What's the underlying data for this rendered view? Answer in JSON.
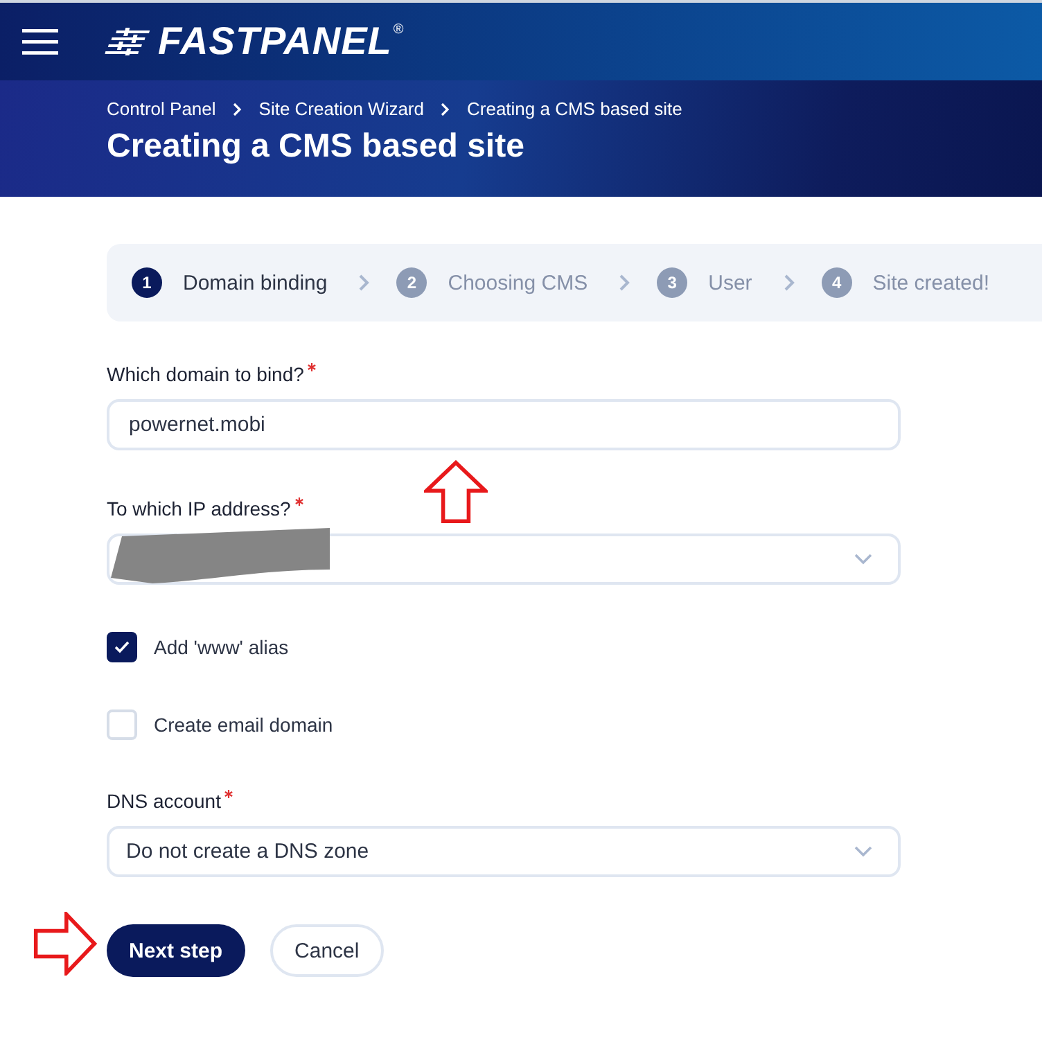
{
  "header": {
    "logo": "FASTPANEL",
    "logo_mark": "®"
  },
  "breadcrumbs": [
    "Control Panel",
    "Site Creation Wizard",
    "Creating a CMS based site"
  ],
  "page_title": "Creating a CMS based site",
  "steps": [
    {
      "number": "1",
      "label": "Domain binding",
      "selected": true
    },
    {
      "number": "2",
      "label": "Choosing CMS",
      "selected": false
    },
    {
      "number": "3",
      "label": "User",
      "selected": false
    },
    {
      "number": "4",
      "label": "Site created!",
      "selected": false
    }
  ],
  "form": [
    {
      "kind": "text",
      "label": "Which domain to bind?",
      "required": true,
      "value": "powernet.mobi"
    },
    {
      "kind": "select",
      "label": "To which IP address?",
      "required": true,
      "redacted": true
    },
    {
      "kind": "checkbox",
      "label": "Add 'www' alias",
      "checked": true
    },
    {
      "kind": "checkbox",
      "label": "Create email domain",
      "checked": false
    },
    {
      "kind": "select",
      "label": "DNS account",
      "required": true,
      "value": "Do not create a DNS zone"
    }
  ],
  "annotation_arrows": [
    {
      "kind": "up"
    },
    {
      "kind": "right"
    }
  ],
  "buttons": [
    {
      "label": "Next step",
      "kind": "primary"
    },
    {
      "label": "Cancel",
      "kind": "secondary"
    }
  ]
}
